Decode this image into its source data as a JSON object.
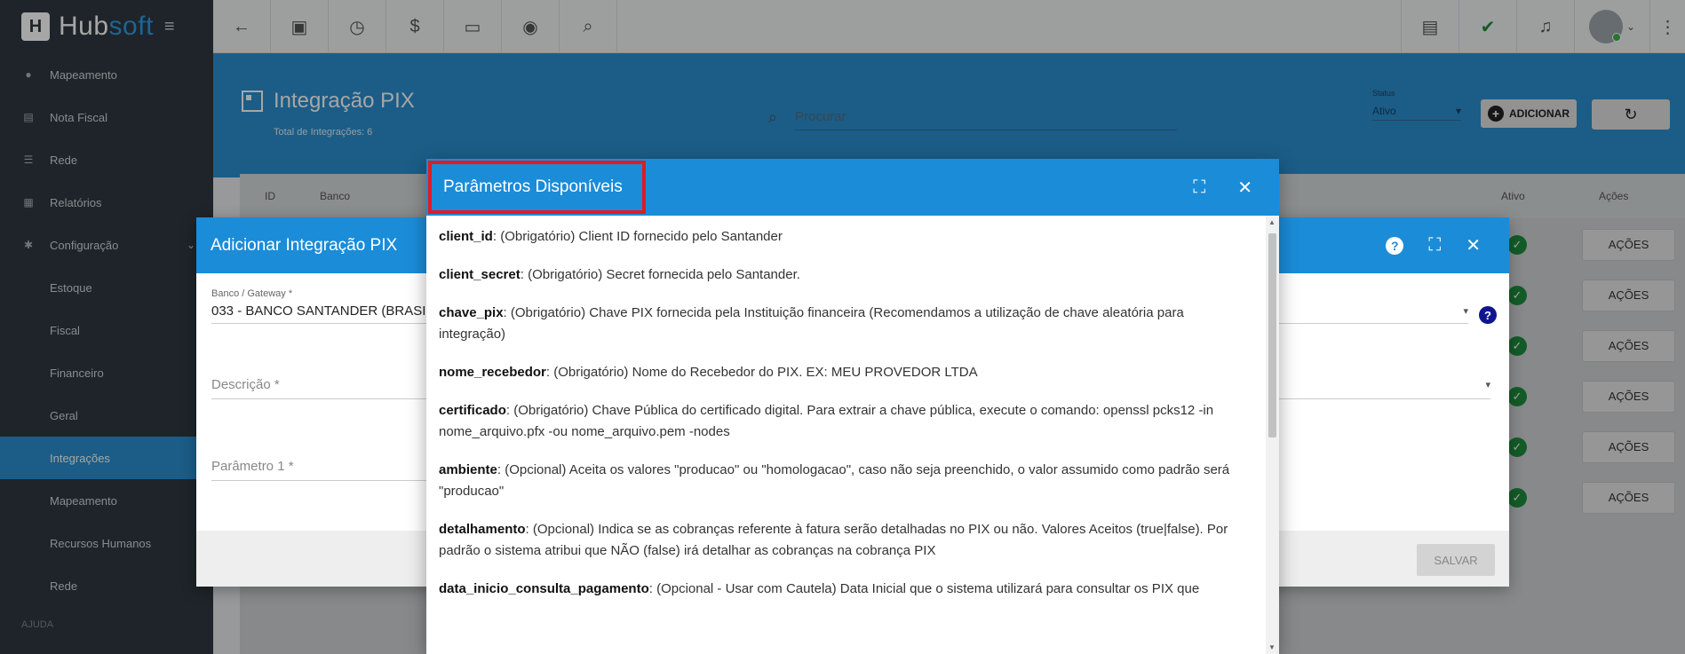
{
  "app": {
    "brand_main": "Hub",
    "brand_accent": "soft"
  },
  "sidebar": {
    "items": [
      {
        "label": "Mapeamento",
        "icon": "map-pin-icon"
      },
      {
        "label": "Nota Fiscal",
        "icon": "receipt-icon"
      },
      {
        "label": "Rede",
        "icon": "server-icon"
      },
      {
        "label": "Relatórios",
        "icon": "report-icon"
      },
      {
        "label": "Configuração",
        "icon": "gear-icon"
      }
    ],
    "subitems": [
      "Estoque",
      "Fiscal",
      "Financeiro",
      "Geral",
      "Integrações",
      "Mapeamento",
      "Recursos Humanos",
      "Rede"
    ],
    "section_help": "AJUDA"
  },
  "header": {
    "title": "Integração PIX",
    "subtitle": "Total de Integrações: 6",
    "search_placeholder": "Procurar",
    "status_label": "Status",
    "status_value": "Ativo",
    "add_label": "ADICIONAR"
  },
  "table": {
    "columns": {
      "id": "ID",
      "banco": "Banco",
      "ativo": "Ativo",
      "acoes": "Ações"
    },
    "row_action": "AÇÕES",
    "row_count": 6
  },
  "dialog_add": {
    "title": "Adicionar Integração PIX",
    "banco_label": "Banco / Gateway *",
    "banco_value": "033 - BANCO SANTANDER (BRASI",
    "descricao_label": "Descrição *",
    "parametro_label": "Parâmetro 1 *",
    "save_label": "SALVAR"
  },
  "dialog_params": {
    "title": "Parâmetros Disponíveis",
    "params": [
      {
        "name": "client_id",
        "desc": ": (Obrigatório) Client ID fornecido pelo Santander"
      },
      {
        "name": "client_secret",
        "desc": ": (Obrigatório) Secret fornecida pelo Santander."
      },
      {
        "name": "chave_pix",
        "desc": ": (Obrigatório) Chave PIX fornecida pela Instituição financeira (Recomendamos a utilização de chave aleatória para integração)"
      },
      {
        "name": "nome_recebedor",
        "desc": ": (Obrigatório) Nome do Recebedor do PIX. EX: MEU PROVEDOR LTDA"
      },
      {
        "name": "certificado",
        "desc": ": (Obrigatório) Chave Pública do certificado digital. Para extrair a chave pública, execute o comando: openssl pcks12 -in nome_arquivo.pfx -ou nome_arquivo.pem -nodes"
      },
      {
        "name": "ambiente",
        "desc": ": (Opcional) Aceita os valores \"producao\" ou \"homologacao\", caso não seja preenchido, o valor assumido como padrão será \"producao\""
      },
      {
        "name": "detalhamento",
        "desc": ": (Opcional) Indica se as cobranças referente à fatura serão detalhadas no PIX ou não. Valores Aceitos (true|false). Por padrão o sistema atribui que NÃO (false) irá detalhar as cobranças na cobrança PIX"
      },
      {
        "name": "data_inicio_consulta_pagamento",
        "desc": ": (Opcional - Usar com Cautela) Data Inicial que o sistema utilizará para consultar os PIX que"
      }
    ]
  },
  "colors": {
    "accent": "#1b8cd8",
    "sidebar_bg": "#2f3840",
    "highlight_border": "#e01b24",
    "success": "#1e8e3e"
  }
}
